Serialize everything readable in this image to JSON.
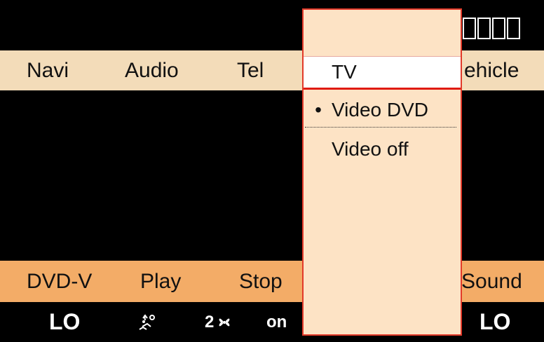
{
  "top_status": {
    "clock_glyph_count": 4
  },
  "top_menu": {
    "items": [
      {
        "label": "Navi"
      },
      {
        "label": "Audio"
      },
      {
        "label": "Tel"
      },
      {
        "label": "ehicle"
      }
    ]
  },
  "dropdown": {
    "header_label": "TV",
    "options": [
      {
        "label": "Video DVD",
        "selected": true,
        "bullet": "•"
      },
      {
        "label": "Video off",
        "selected": false,
        "bullet": ""
      }
    ]
  },
  "bottom_bar": {
    "items": [
      {
        "label": "DVD-V"
      },
      {
        "label": "Play"
      },
      {
        "label": "Stop"
      },
      {
        "label": "Sound"
      }
    ]
  },
  "climate": {
    "left_temp": "LO",
    "airflow_icon": "airflow-icon",
    "fan_speed": "2",
    "fan_icon": "fan-icon",
    "ac_status": "on",
    "right_temp": "LO"
  },
  "colors": {
    "background": "#000000",
    "top_bar": "#f3dcb9",
    "bottom_bar": "#f3ac67",
    "dropdown": "#fde3c5",
    "dropdown_border": "#e23a2a",
    "text_dark": "#111111",
    "text_light": "#ffffff"
  }
}
